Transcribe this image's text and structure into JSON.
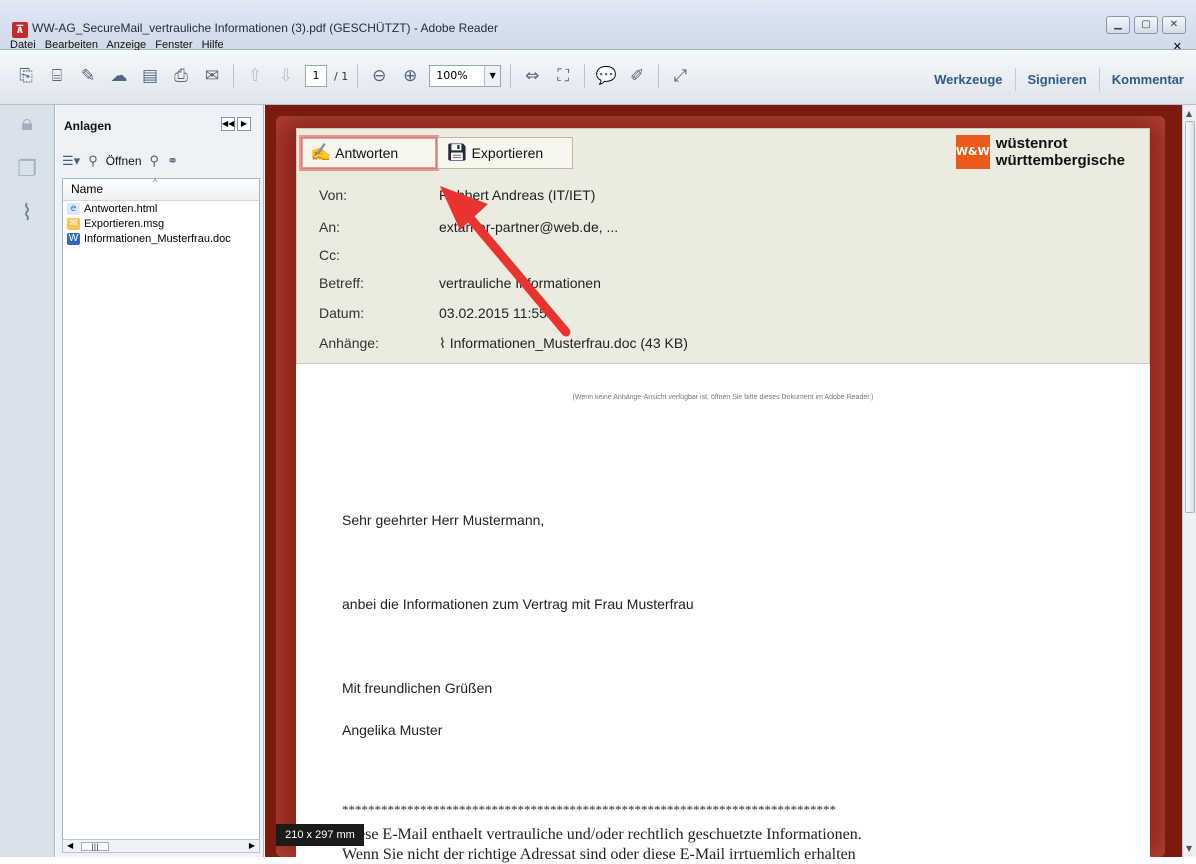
{
  "window": {
    "title": "WW-AG_SecureMail_vertrauliche Informationen (3).pdf (GESCHÜTZT) - Adobe Reader",
    "menu": [
      "Datei",
      "Bearbeiten",
      "Anzeige",
      "Fenster",
      "Hilfe"
    ]
  },
  "toolbar": {
    "page_current": "1",
    "page_total": "/ 1",
    "zoom": "100%",
    "right_tabs": [
      "Werkzeuge",
      "Signieren",
      "Kommentar"
    ]
  },
  "attachments_panel": {
    "title": "Anlagen",
    "open_label": "Öffnen",
    "column_name": "Name",
    "files": [
      {
        "name": "Antworten.html",
        "icon": "html-file-icon"
      },
      {
        "name": "Exportieren.msg",
        "icon": "mail-file-icon"
      },
      {
        "name": "Informationen_Musterfrau.doc",
        "icon": "word-file-icon"
      }
    ]
  },
  "email": {
    "buttons": {
      "reply": "Antworten",
      "export": "Exportieren"
    },
    "brand": {
      "line1": "wüstenrot",
      "line2": "württembergische",
      "logo": "W&W"
    },
    "fields": [
      {
        "label": "Von:",
        "value": "Robbert Andreas (IT/IET)"
      },
      {
        "label": "An:",
        "value": "extarner-partner@web.de, ..."
      },
      {
        "label": "Cc:",
        "value": ""
      },
      {
        "label": "Betreff:",
        "value": "vertrauliche Informationen"
      },
      {
        "label": "Datum:",
        "value": "03.02.2015 11:55"
      },
      {
        "label": "Anhänge:",
        "value": "Informationen_Musterfrau.doc (43 KB)"
      }
    ],
    "note": "(Wenn keine Anhänge-Ansicht verfügbar ist, öffnen Sie bitte dieses Dokument im Adobe Reader.)",
    "greeting": "Sehr geehrter Herr Mustermann,",
    "body": "anbei die Informationen zum Vertrag mit Frau Musterfrau",
    "closing": "Mit freundlichen Grüßen",
    "signature": "Angelika Muster",
    "stars": "****************************************************************************",
    "disclaimer1": "Diese E-Mail enthaelt vertrauliche und/oder rechtlich geschuetzte Informationen.",
    "disclaimer2": "Wenn Sie nicht der richtige Adressat sind oder diese E-Mail irrtuemlich erhalten"
  },
  "page_size": "210 x 297 mm",
  "colors": {
    "doc_background": "#7b1a0e",
    "header": "#ecebdf",
    "accent_arrow": "#e8332f",
    "brand": "#ea5a1a"
  }
}
